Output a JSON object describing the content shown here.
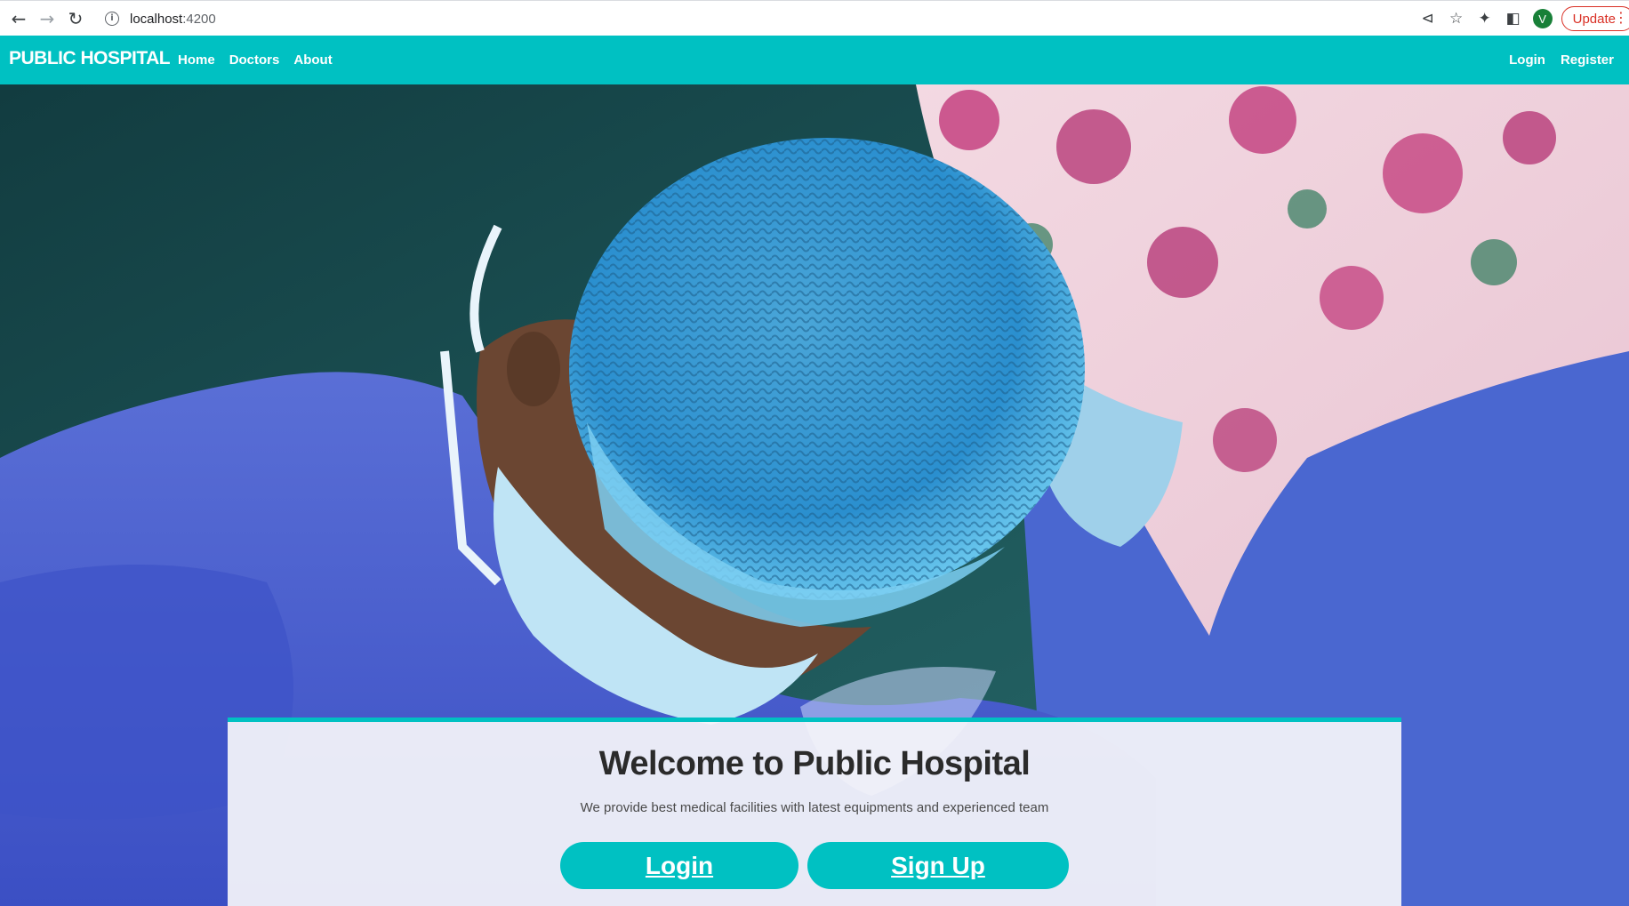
{
  "browser": {
    "url_host": "localhost",
    "url_port": ":4200",
    "profile_initial": "V",
    "update_label": "Update"
  },
  "navbar": {
    "brand": "PUBLIC HOSPITAL",
    "left_links": [
      "Home",
      "Doctors",
      "About"
    ],
    "right_links": [
      "Login",
      "Register"
    ],
    "accent_color": "#00c1c2"
  },
  "hero": {
    "image_subject": "surgeons-in-operating-room"
  },
  "welcome": {
    "title": "Welcome to Public Hospital",
    "subtitle": "We provide best medical facilities with latest equipments and experienced team",
    "login_button": "Login",
    "signup_button": "Sign Up"
  }
}
